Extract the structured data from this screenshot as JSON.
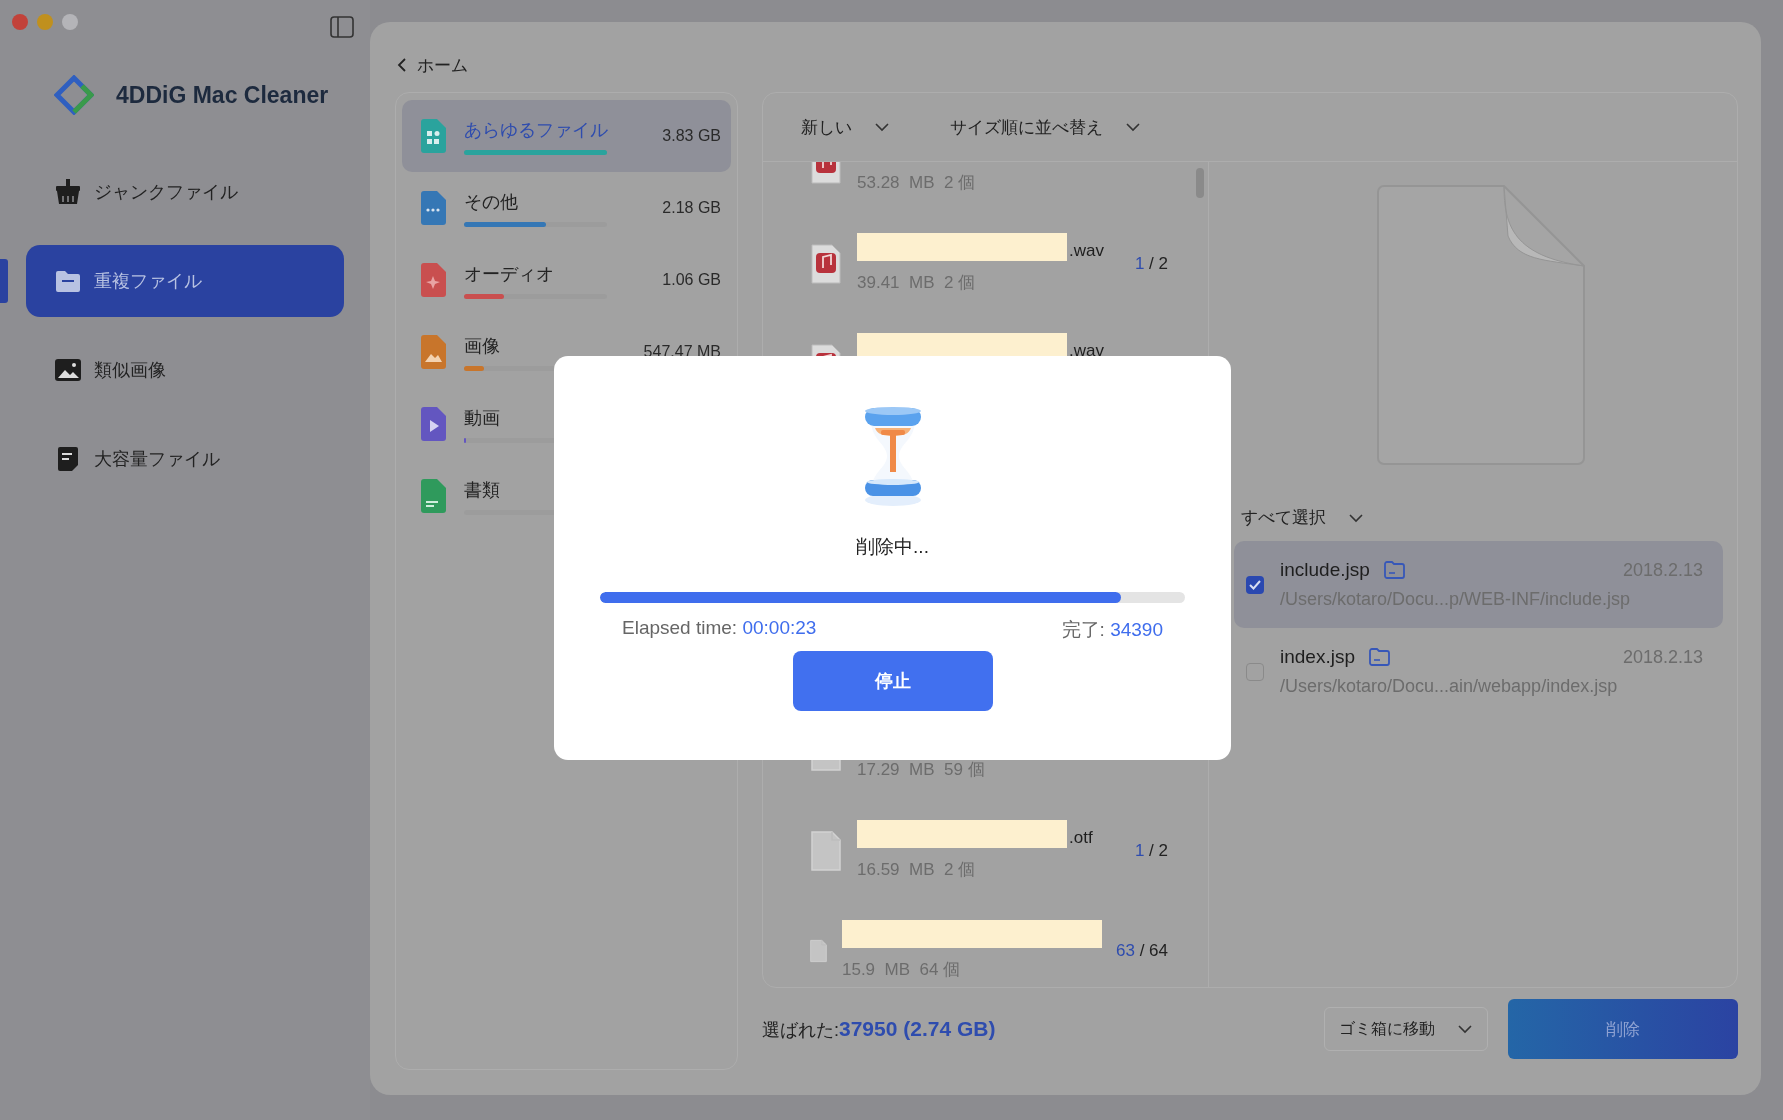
{
  "window": {
    "traffic_lights": [
      {
        "kind": "close"
      },
      {
        "kind": "minimize"
      },
      {
        "kind": "zoom"
      }
    ]
  },
  "app": {
    "name": "4DDiG Mac Cleaner"
  },
  "sidebar": {
    "items": [
      {
        "label": "ジャンクファイル",
        "kind": "junk",
        "selected": false
      },
      {
        "label": "重複ファイル",
        "kind": "folder",
        "selected": true
      },
      {
        "label": "類似画像",
        "kind": "image",
        "selected": false
      },
      {
        "label": "大容量ファイル",
        "kind": "large",
        "selected": false
      }
    ]
  },
  "back": {
    "label": "ホーム"
  },
  "categories": [
    {
      "label": "あらゆるファイル",
      "size": "3.83  GB",
      "level": 1,
      "color": "#2aa39d",
      "kind": "all",
      "selected": true
    },
    {
      "label": "その他",
      "size": "2.18  GB",
      "level": 0.57,
      "color": "#3577b5",
      "kind": "other",
      "selected": false
    },
    {
      "label": "オーディオ",
      "size": "1.06  GB",
      "level": 0.28,
      "color": "#c94f4f",
      "kind": "audio",
      "selected": false
    },
    {
      "label": "画像",
      "size": "547.47  MB",
      "level": 0.14,
      "color": "#c8752b",
      "kind": "image",
      "selected": false
    },
    {
      "label": "動画",
      "level": 0.01,
      "color": "#6356c0",
      "kind": "video",
      "selected": false
    },
    {
      "label": "書類",
      "color": "#2f9a5c",
      "kind": "doc",
      "selected": false
    }
  ],
  "list_header": {
    "filters": [
      "新しい",
      "サイズ順に並べ替え"
    ]
  },
  "file_list": {
    "upper_rows": [
      {
        "kind": "audio",
        "size": "53.28  MB  2 個"
      },
      {
        "kind": "audio",
        "redacted": true,
        "suffix": ".wav",
        "size": "39.41  MB  2 個",
        "selected_count": "1",
        "total": " / 2"
      },
      {
        "kind": "audio",
        "redacted": true,
        "suffix": ".wav"
      }
    ],
    "lower_rows": [
      {
        "kind": "blank",
        "size": "17.29  MB  59 個"
      },
      {
        "kind": "blank",
        "redacted": true,
        "suffix": ".otf",
        "size": "16.59  MB  2 個",
        "selected_count": "1",
        "total": " / 2"
      },
      {
        "kind": "blank",
        "redacted": true,
        "size": "15.9  MB  64 個",
        "selected_count": "63",
        "total": " / 64"
      }
    ]
  },
  "preview": {
    "select_all": "すべて選択",
    "files": [
      {
        "name": "include.jsp",
        "date": "2018.2.13",
        "path": "/Users/kotaro/Docu...p/WEB-INF/include.jsp",
        "checked": true,
        "selected": true
      },
      {
        "name": "index.jsp",
        "date": "2018.2.13",
        "path": "/Users/kotaro/Docu...ain/webapp/index.jsp",
        "checked": false,
        "selected": false
      }
    ]
  },
  "footer": {
    "selected_label": "選ばれた:",
    "selected_value": "37950 (2.74  GB)",
    "mode": "ゴミ箱に移動",
    "delete": "削除"
  },
  "dialog": {
    "status": "削除中...",
    "level": 0.89,
    "elapsed_label": "Elapsed time: ",
    "elapsed": "00:00:23",
    "done_label": "完了: ",
    "done": "34390",
    "stop": "停止"
  }
}
